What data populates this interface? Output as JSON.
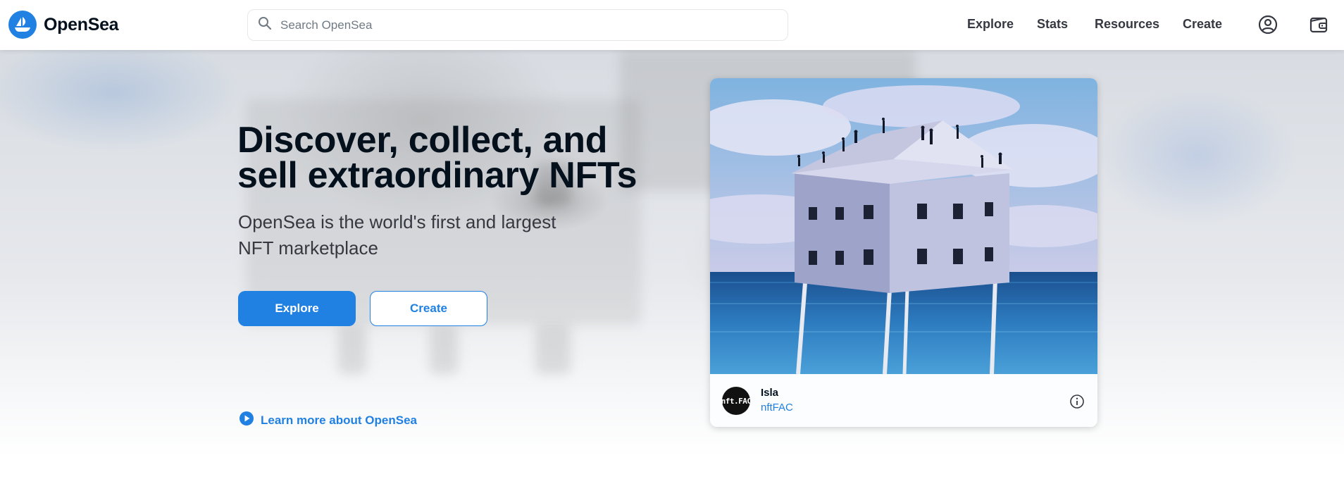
{
  "brand": {
    "name": "OpenSea",
    "logo_icon": "ship-icon",
    "accent": "#2081e2"
  },
  "search": {
    "placeholder": "Search OpenSea",
    "value": "",
    "icon": "search-icon"
  },
  "nav": {
    "links": [
      {
        "label": "Explore"
      },
      {
        "label": "Stats"
      },
      {
        "label": "Resources"
      },
      {
        "label": "Create"
      }
    ],
    "account_icon": "account-circle-icon",
    "wallet_icon": "wallet-icon"
  },
  "hero": {
    "headline": "Discover, collect, and sell extraordinary NFTs",
    "subheadline": "OpenSea is the world's first and largest NFT marketplace",
    "primary_button": "Explore",
    "secondary_button": "Create",
    "learn_more": {
      "label": "Learn more about OpenSea",
      "icon": "play-circle-icon"
    }
  },
  "featured": {
    "title": "Isla",
    "creator": "nftFAC",
    "avatar_text": "nft.FAC",
    "art_icon": "painting-house-on-stilts-image",
    "info_icon": "info-icon"
  }
}
